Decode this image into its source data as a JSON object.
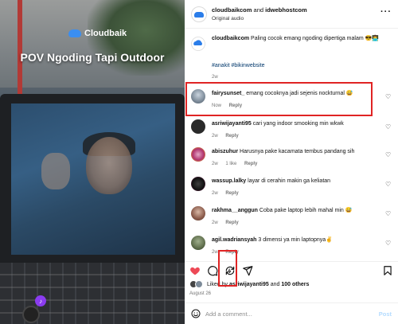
{
  "video": {
    "brand": "Cloudbaik",
    "title": "POV Ngoding Tapi Outdoor"
  },
  "header": {
    "author": "cloudbaikcom",
    "connector": "and",
    "coauthor": "idwebhostcom",
    "audio": "Original audio",
    "more": "···"
  },
  "caption": {
    "author": "cloudbaikcom",
    "text": "Paling cocok emang ngoding dipertiga malam 😎👨‍💻",
    "tags": "#anakit #bikinwebsite",
    "time": "2w"
  },
  "comments": [
    {
      "user": "fairysunset_",
      "text": "emang cocoknya jadi sejenis nockturnal 😅",
      "time": "Now",
      "likes": "",
      "reply": "Reply"
    },
    {
      "user": "asriwijayanti95",
      "text": "cari yang indoor smooking min wkwk",
      "time": "2w",
      "likes": "",
      "reply": "Reply"
    },
    {
      "user": "abiszuhur",
      "text": "Harusnya pake kacamata tembus pandang sih",
      "time": "2w",
      "likes": "1 like",
      "reply": "Reply"
    },
    {
      "user": "wassup.lalky",
      "text": "layar di cerahin makin ga keliatan",
      "time": "2w",
      "likes": "",
      "reply": "Reply"
    },
    {
      "user": "rakhma__anggun",
      "text": "Coba pake laptop lebih mahal min 😅",
      "time": "2w",
      "likes": "",
      "reply": "Reply"
    },
    {
      "user": "agil.wadriansyah",
      "text": "3 dimensi ya min laptopnya✌️",
      "time": "2w",
      "likes": "",
      "reply": "Reply"
    }
  ],
  "likes": {
    "prefix": "Liked by",
    "user": "asriwijayanti95",
    "connector": "and",
    "others": "100 others"
  },
  "date": "August 26",
  "add_comment": {
    "placeholder": "Add a comment...",
    "post": "Post"
  },
  "icons": {
    "like": "heart-filled-icon",
    "comment": "comment-icon",
    "remix": "remix-icon",
    "share": "share-icon",
    "save": "bookmark-icon",
    "emoji": "emoji-icon"
  },
  "colors": {
    "heart": "#ed4956",
    "highlight": "#e02424",
    "link": "#00376b",
    "post": "#b3dbff"
  }
}
